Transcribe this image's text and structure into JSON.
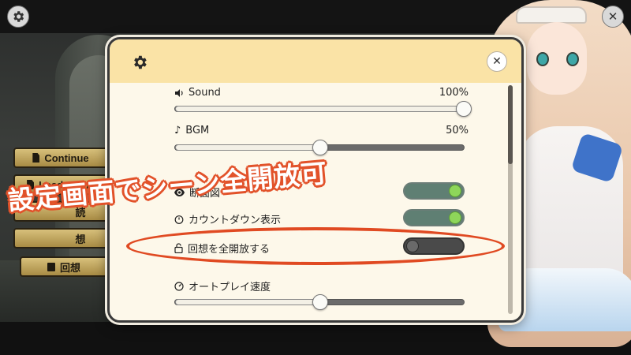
{
  "top_buttons": {
    "settings_icon": "gear-icon",
    "close_icon": "close-icon",
    "close_glyph": "✕"
  },
  "menu": {
    "items": [
      {
        "label": "Continue",
        "icon": "document-icon"
      },
      {
        "label": "Load Game",
        "icon": "document-icon"
      },
      {
        "label": "読",
        "icon": "document-icon"
      },
      {
        "label": "想",
        "icon": "book-icon"
      }
    ],
    "gallery_label": "回想"
  },
  "dialog": {
    "gear_icon": "gear-icon",
    "close_glyph": "✕",
    "sound": {
      "label": "Sound",
      "icon": "speaker-icon",
      "value_text": "100%",
      "value": 1.0
    },
    "bgm": {
      "label": "BGM",
      "icon": "music-note-icon",
      "value_text": "50%",
      "value": 0.5
    },
    "cross_section": {
      "label": "断面図",
      "icon": "eye-icon",
      "state": "on"
    },
    "countdown": {
      "label": "カウントダウン表示",
      "icon": "timer-icon",
      "state": "on"
    },
    "unlock_recall": {
      "label": "回想を全開放する",
      "icon": "lock-icon",
      "state": "off"
    },
    "auto_play": {
      "label": "オートプレイ速度",
      "icon": "gauge-icon",
      "value": 0.5
    }
  },
  "overlay": {
    "caption": "設定画面でシーン全開放可"
  },
  "colors": {
    "header": "#fae3a6",
    "panel": "#fdf8ea",
    "toggle_on": "#5f7f73",
    "knob_on": "#8ed65a",
    "highlight": "#e04a22"
  }
}
